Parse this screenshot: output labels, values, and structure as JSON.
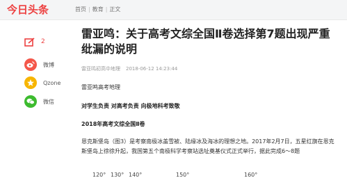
{
  "header": {
    "logo": "今日头条",
    "breadcrumb": [
      "首页",
      "教育",
      "正文"
    ]
  },
  "sidebar": {
    "comment_count": "2",
    "share": [
      {
        "label": "微博",
        "icon": "weibo-icon",
        "color": "#f4574a"
      },
      {
        "label": "Qzone",
        "icon": "qzone-icon",
        "color": "#f7b500"
      },
      {
        "label": "微信",
        "icon": "wechat-icon",
        "color": "#3dbb2f"
      }
    ]
  },
  "article": {
    "title": "雷亚鸣：关于高考文综全国Ⅱ卷选择第7题出现严重纰漏的说明",
    "source": "雷亚鸣初高中地理",
    "date": "2018-06-12 14:23:44",
    "para1": "雷亚鸣高考地理",
    "para2": "对学生负责 对高考负责 向极地科考致敬",
    "para3": "2018年高考文综全国Ⅱ卷",
    "para4": "恩克斯堡岛（图3）是考察南极冰盖雪被、陆缘冰及海冰的理想之地。2017年2月7日，五星红旗在恩克斯堡岛上徐徐升起，我国第五个南极科学考察站选址奠基仪式正式举行，据此完成6～8题",
    "figure_labels": [
      "120°",
      "130°",
      "140°",
      "150°",
      "160°"
    ]
  },
  "colors": {
    "brand": "#ed4040"
  }
}
